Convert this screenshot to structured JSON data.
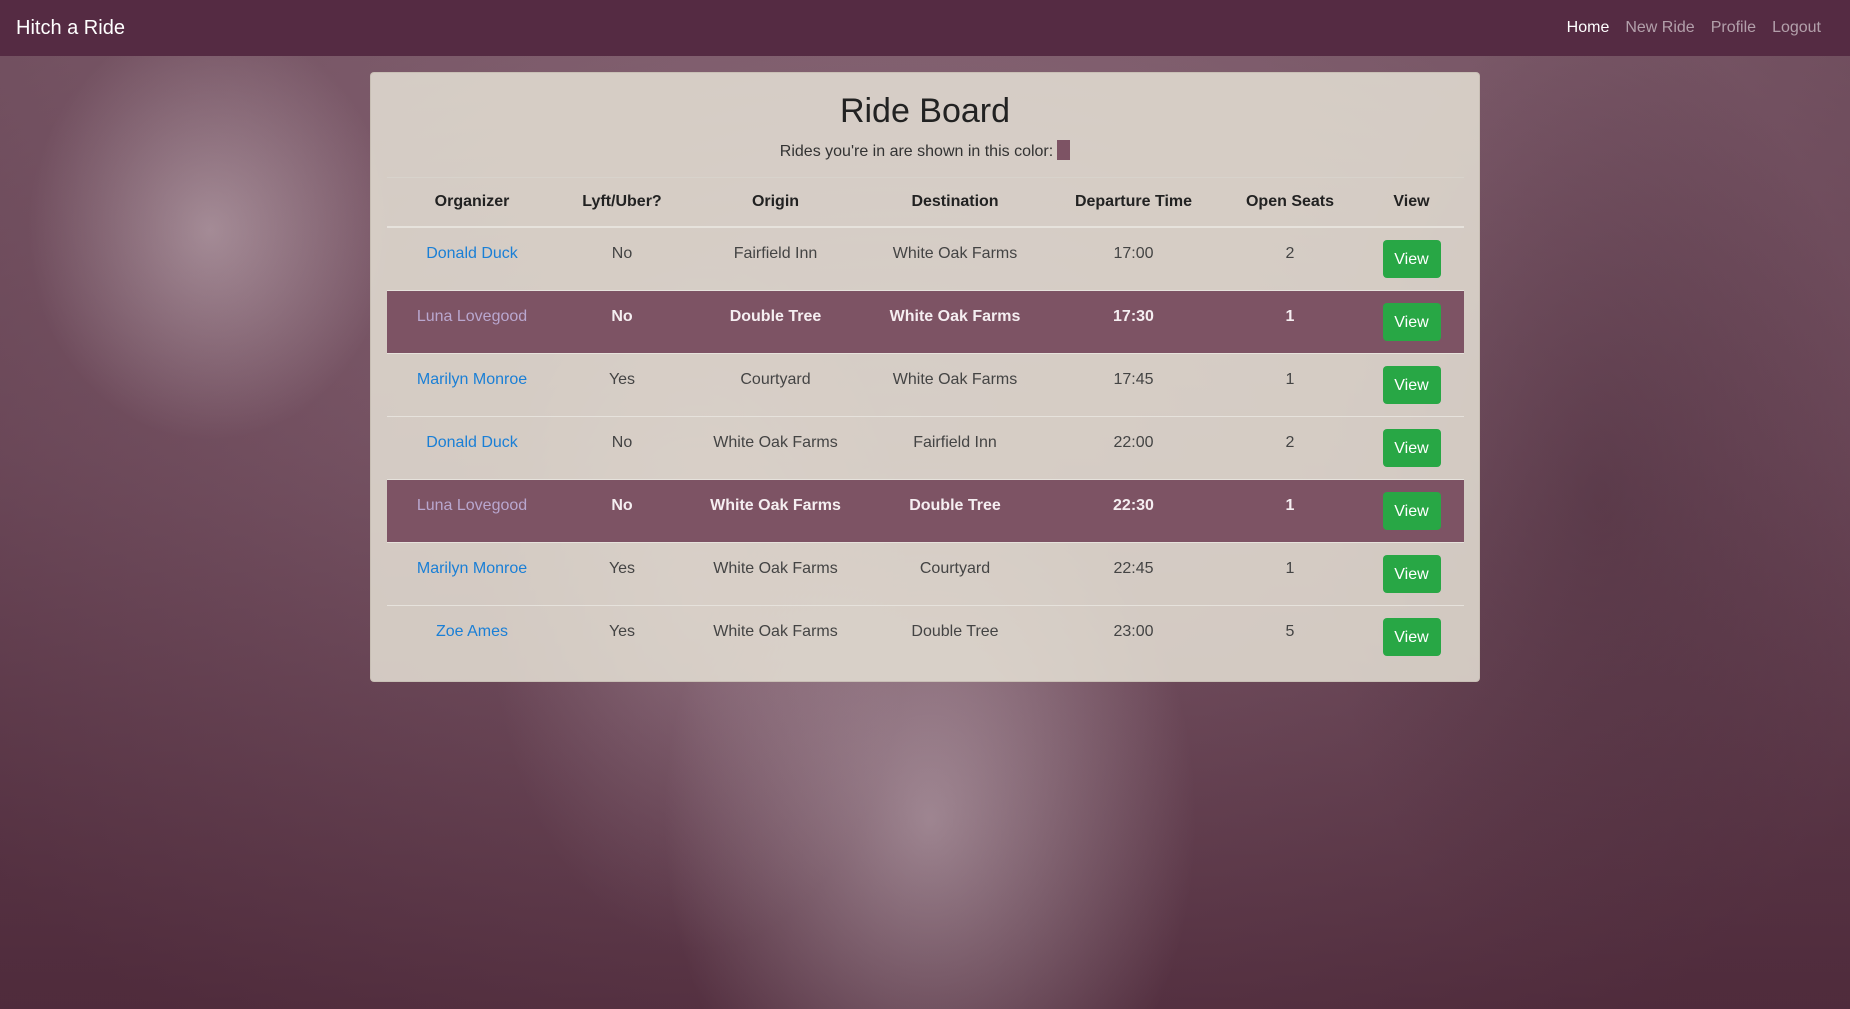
{
  "navbar": {
    "brand": "Hitch a Ride",
    "links": [
      {
        "label": "Home",
        "active": true
      },
      {
        "label": "New Ride",
        "active": false
      },
      {
        "label": "Profile",
        "active": false
      },
      {
        "label": "Logout",
        "active": false
      }
    ]
  },
  "board": {
    "title": "Ride Board",
    "legend_text": "Rides you're in are shown in this color:",
    "highlight_color": "#7d5364",
    "columns": [
      "Organizer",
      "Lyft/Uber?",
      "Origin",
      "Destination",
      "Departure Time",
      "Open Seats",
      "View"
    ],
    "rows": [
      {
        "organizer": "Donald Duck",
        "rideshare": "No",
        "origin": "Fairfield Inn",
        "destination": "White Oak Farms",
        "time": "17:00",
        "seats": "2",
        "view": "View",
        "mine": false
      },
      {
        "organizer": "Luna Lovegood",
        "rideshare": "No",
        "origin": "Double Tree",
        "destination": "White Oak Farms",
        "time": "17:30",
        "seats": "1",
        "view": "View",
        "mine": true
      },
      {
        "organizer": "Marilyn Monroe",
        "rideshare": "Yes",
        "origin": "Courtyard",
        "destination": "White Oak Farms",
        "time": "17:45",
        "seats": "1",
        "view": "View",
        "mine": false
      },
      {
        "organizer": "Donald Duck",
        "rideshare": "No",
        "origin": "White Oak Farms",
        "destination": "Fairfield Inn",
        "time": "22:00",
        "seats": "2",
        "view": "View",
        "mine": false
      },
      {
        "organizer": "Luna Lovegood",
        "rideshare": "No",
        "origin": "White Oak Farms",
        "destination": "Double Tree",
        "time": "22:30",
        "seats": "1",
        "view": "View",
        "mine": true
      },
      {
        "organizer": "Marilyn Monroe",
        "rideshare": "Yes",
        "origin": "White Oak Farms",
        "destination": "Courtyard",
        "time": "22:45",
        "seats": "1",
        "view": "View",
        "mine": false
      },
      {
        "organizer": "Zoe Ames",
        "rideshare": "Yes",
        "origin": "White Oak Farms",
        "destination": "Double Tree",
        "time": "23:00",
        "seats": "5",
        "view": "View",
        "mine": false
      }
    ]
  },
  "colors": {
    "navbar": "#552b43",
    "view_button": "#28a745",
    "link": "#1a7fd6"
  }
}
